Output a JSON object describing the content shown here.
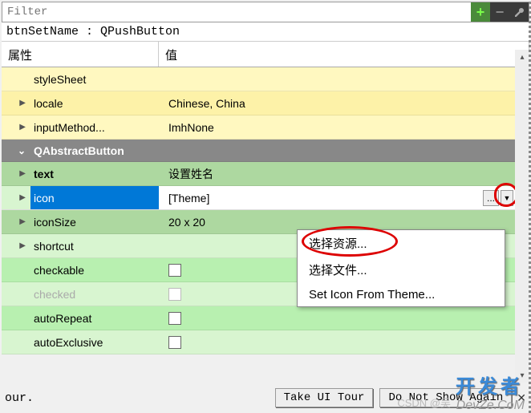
{
  "filter": {
    "placeholder": "Filter"
  },
  "object_line": "btnSetName : QPushButton",
  "headers": {
    "property": "属性",
    "value": "值"
  },
  "rows": {
    "styleSheet": {
      "name": "styleSheet",
      "value": ""
    },
    "locale": {
      "name": "locale",
      "value": "Chinese, China"
    },
    "inputMethod": {
      "name": "inputMethod...",
      "value": "ImhNone"
    },
    "section": {
      "name": "QAbstractButton"
    },
    "text": {
      "name": "text",
      "value": "设置姓名"
    },
    "icon": {
      "name": "icon",
      "value": "[Theme]"
    },
    "iconSize": {
      "name": "iconSize",
      "value": "20 x 20"
    },
    "shortcut": {
      "name": "shortcut",
      "value": ""
    },
    "checkable": {
      "name": "checkable"
    },
    "checked": {
      "name": "checked"
    },
    "autoRepeat": {
      "name": "autoRepeat"
    },
    "autoExclusive": {
      "name": "autoExclusive"
    }
  },
  "menu": {
    "choose_resource": "选择资源...",
    "choose_file": "选择文件...",
    "set_from_theme": "Set Icon From Theme..."
  },
  "footer": {
    "our": "our.",
    "take_tour": "Take UI Tour",
    "do_not_show": "Do Not Show Again"
  },
  "buttons": {
    "dots": "...",
    "dropdown": "▼",
    "reset": "↶"
  },
  "watermarks": {
    "w1": "开发者",
    "w2": "DevZe.CoM",
    "w3": "CSDN @吴"
  }
}
